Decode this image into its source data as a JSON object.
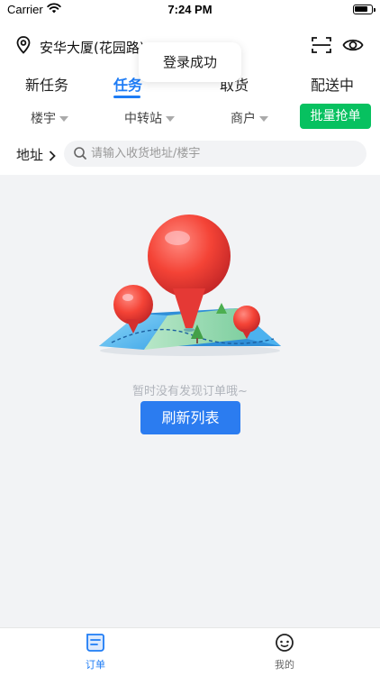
{
  "status_bar": {
    "carrier": "Carrier",
    "time": "7:24 PM",
    "battery_level": 0.85
  },
  "header": {
    "location": "安华大厦(花园路)",
    "location_icon": "location-pin-icon",
    "scan_icon": "scan-icon",
    "eye_icon": "eye-icon"
  },
  "tabs": [
    {
      "label": "新任务",
      "active": false
    },
    {
      "label": "任务",
      "active": true
    },
    {
      "label": "取货",
      "active": false
    },
    {
      "label": "配送中",
      "active": false
    }
  ],
  "toast": {
    "text": "登录成功"
  },
  "filters": [
    {
      "label": "楼宇"
    },
    {
      "label": "中转站"
    },
    {
      "label": "商户"
    }
  ],
  "batch_grab_label": "批量抢单",
  "search": {
    "label": "地址",
    "placeholder": "请输入收货地址/楼宇"
  },
  "empty_state": {
    "text": "暂时没有发现订单哦~",
    "button": "刷新列表"
  },
  "tabbar": [
    {
      "label": "订单",
      "icon": "orders-icon",
      "active": true
    },
    {
      "label": "我的",
      "icon": "profile-icon",
      "active": false
    }
  ],
  "colors": {
    "accent": "#1e7cf5",
    "grab_button": "#07c160",
    "refresh_button": "#2b7cf0",
    "background": "#f2f3f5"
  }
}
